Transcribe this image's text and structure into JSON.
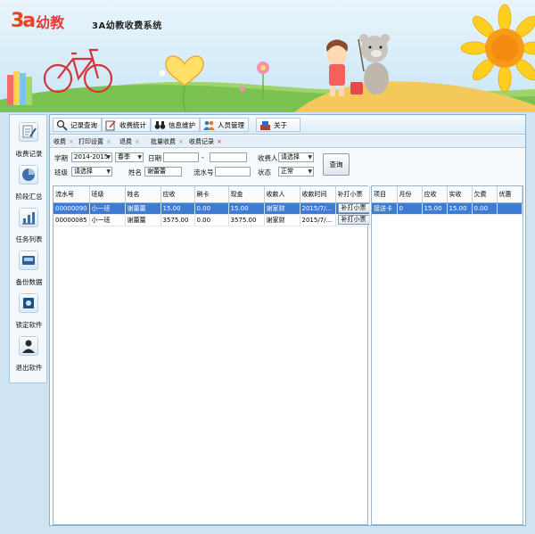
{
  "app": {
    "logo_mark": "3a",
    "logo_word": "幼教",
    "title": "3A幼教收费系统"
  },
  "sidebar": {
    "items": [
      {
        "label": "收费记录",
        "icon": "document-pen-icon"
      },
      {
        "label": "阶段汇总",
        "icon": "pie-chart-icon"
      },
      {
        "label": "任务列表",
        "icon": "bar-chart-icon"
      },
      {
        "label": "备份数据",
        "icon": "backup-icon"
      },
      {
        "label": "锁定软件",
        "icon": "lock-icon"
      },
      {
        "label": "退出软件",
        "icon": "user-exit-icon"
      }
    ]
  },
  "toolbar": {
    "buttons": [
      {
        "label": "记录查询",
        "icon": "search-icon"
      },
      {
        "label": "收费统计",
        "icon": "edit-icon"
      },
      {
        "label": "信息维护",
        "icon": "binoculars-icon"
      },
      {
        "label": "人员管理",
        "icon": "people-icon"
      },
      {
        "label": "关于",
        "icon": "info-icon"
      }
    ]
  },
  "tabs": [
    {
      "label": "收费"
    },
    {
      "label": "打印设置"
    },
    {
      "label": "退费"
    },
    {
      "label": "批量收费"
    },
    {
      "label": "收费记录",
      "active": true
    }
  ],
  "filters": {
    "term_label": "学期",
    "term_value": "2014-2015",
    "season_value": "春季",
    "date_label": "日期",
    "date_from": "",
    "date_sep": "-",
    "date_to": "",
    "collector_label": "收费人",
    "collector_value": "请选择",
    "class_label": "班级",
    "class_value": "请选择",
    "name_label": "姓名",
    "name_value": "谢蕾蕾",
    "serial_label": "流水号",
    "serial_value": "",
    "status_label": "状态",
    "status_value": "正常",
    "query_label": "查询"
  },
  "records_table": {
    "headers": [
      "流水号",
      "班级",
      "姓名",
      "应收",
      "刷卡",
      "现金",
      "收款人",
      "收款时间",
      "补打小票"
    ],
    "rows": [
      {
        "serial": "00000090",
        "class": "小一班",
        "name": "谢蕾蕾",
        "receivable": "15.00",
        "card": "0.00",
        "cash": "15.00",
        "payee": "谢家财",
        "time": "2015/7/...",
        "action": "补打小票",
        "selected": true
      },
      {
        "serial": "00000085",
        "class": "小一班",
        "name": "谢蕾蕾",
        "receivable": "3575.00",
        "card": "0.00",
        "cash": "3575.00",
        "payee": "谢家财",
        "time": "2015/7/...",
        "action": "补打小票",
        "selected": false
      }
    ]
  },
  "detail_table": {
    "headers": [
      "项目",
      "月份",
      "应收",
      "实收",
      "欠费",
      "优惠"
    ],
    "rows": [
      {
        "item": "接送卡",
        "month": "0",
        "receivable": "15.00",
        "received": "15.00",
        "owed": "0.00",
        "discount": ""
      }
    ]
  }
}
